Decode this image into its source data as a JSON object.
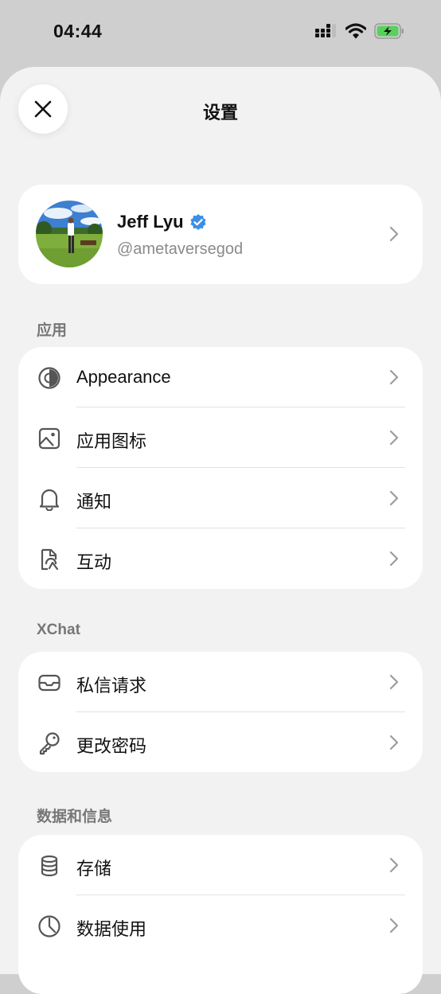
{
  "status_bar": {
    "time": "04:44"
  },
  "header": {
    "title": "设置",
    "close_icon": "close-icon"
  },
  "profile": {
    "name": "Jeff Lyu",
    "handle": "@ametaversegod",
    "verified": true
  },
  "sections": [
    {
      "label": "应用",
      "items": [
        {
          "label": "Appearance",
          "icon": "appearance-icon"
        },
        {
          "label": "应用图标",
          "icon": "image-icon"
        },
        {
          "label": "通知",
          "icon": "bell-icon"
        },
        {
          "label": "互动",
          "icon": "interaction-icon"
        }
      ]
    },
    {
      "label": "XChat",
      "items": [
        {
          "label": "私信请求",
          "icon": "inbox-icon"
        },
        {
          "label": "更改密码",
          "icon": "key-icon"
        }
      ]
    },
    {
      "label": "数据和信息",
      "items": [
        {
          "label": "存储",
          "icon": "database-icon"
        },
        {
          "label": "数据使用",
          "icon": "clock-icon"
        }
      ]
    }
  ],
  "colors": {
    "accent": "#3b8fe6",
    "background": "#f2f2f2",
    "card": "#ffffff",
    "battery": "#58d15c"
  }
}
